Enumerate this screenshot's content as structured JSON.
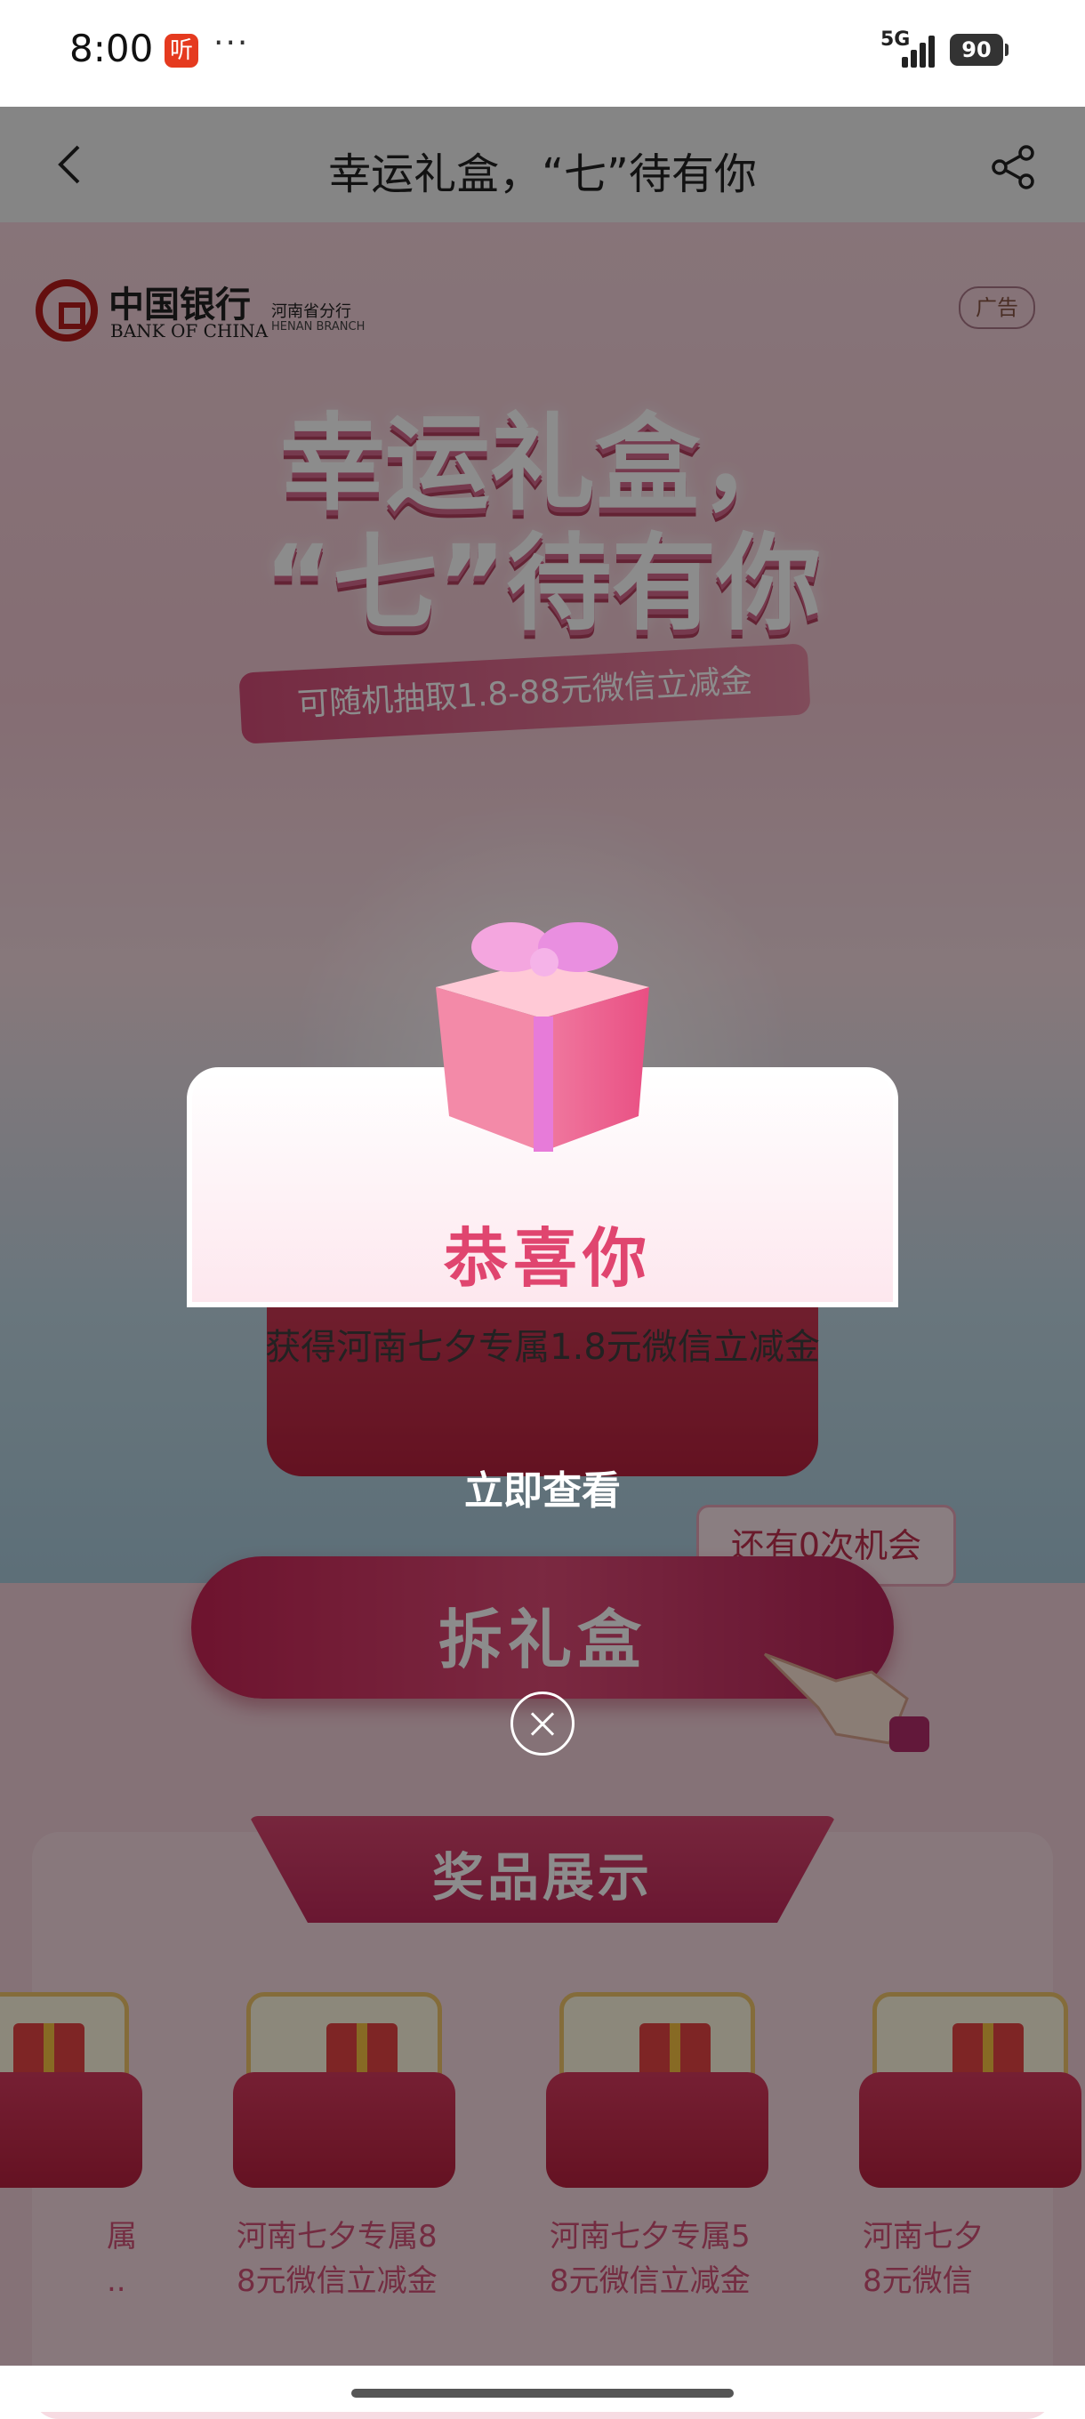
{
  "status_bar": {
    "time": "8:00",
    "app_badge": "听",
    "dots": "···",
    "network": "5G",
    "battery": "90"
  },
  "navbar": {
    "title": "幸运礼盒，“七”待有你",
    "back_icon": "chevron-left-icon",
    "share_icon": "share-icon"
  },
  "poster": {
    "bank_name_cn": "中国银行",
    "bank_name_en": "BANK OF CHINA",
    "branch_cn": "河南省分行",
    "branch_en": "HENAN BRANCH",
    "ad_tag": "广告",
    "headline_line1": "幸运礼盒，",
    "headline_line2": "“七”待有你",
    "subline": "可随机抽取1.8-88元微信立减金"
  },
  "game": {
    "chances": "还有0次机会",
    "open_button": "拆礼盒"
  },
  "prizes": {
    "title": "奖品展示",
    "items": [
      {
        "label": "属\n.."
      },
      {
        "label": "河南七夕专属8\n8元微信立减金"
      },
      {
        "label": "河南七夕专属5\n8元微信立减金"
      },
      {
        "label": "河南七夕\n8元微信"
      }
    ]
  },
  "modal": {
    "title": "恭喜你",
    "message": "获得河南七夕专属1.8元微信立减金",
    "view_button": "立即查看",
    "close_icon": "close-icon"
  },
  "colors": {
    "accent": "#e0456f",
    "brand_red": "#b71c1c",
    "overlay": "rgba(0,0,0,0.45)"
  }
}
